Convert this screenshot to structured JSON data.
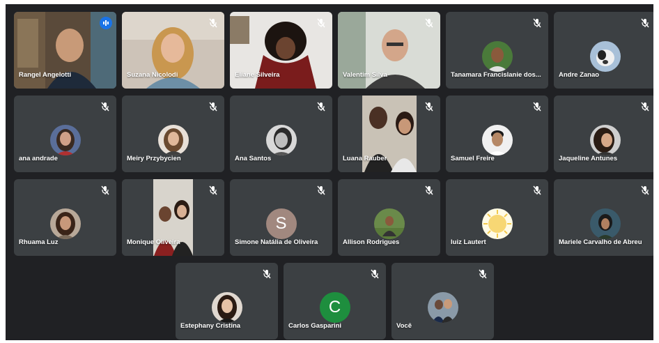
{
  "meeting": {
    "colors": {
      "background": "#202124",
      "tile": "#3c4043",
      "speaking_outline": "#8ab4f8",
      "speaking_badge": "#1a73e8"
    },
    "participants": [
      {
        "name": "Rangel Angelotti",
        "type": "video",
        "speaking": true,
        "muted": false
      },
      {
        "name": "Suzana Nicolodi",
        "type": "video",
        "muted": true
      },
      {
        "name": "Eliane Silveira",
        "type": "video",
        "muted": true
      },
      {
        "name": "Valentim Silva",
        "type": "video",
        "muted": true
      },
      {
        "name": "Tanamara Francislanie dos...",
        "type": "avatar",
        "muted": true
      },
      {
        "name": "Andre Zanao",
        "type": "avatar",
        "muted": true
      },
      {
        "name": "ana andrade",
        "type": "avatar",
        "muted": true
      },
      {
        "name": "Meiry Przybycien",
        "type": "avatar",
        "muted": true
      },
      {
        "name": "Ana Santos",
        "type": "avatar",
        "muted": true
      },
      {
        "name": "Luana Rauber",
        "type": "video",
        "muted": true
      },
      {
        "name": "Samuel Freire",
        "type": "avatar",
        "muted": true
      },
      {
        "name": "Jaqueline Antunes",
        "type": "avatar",
        "muted": true
      },
      {
        "name": "Rhuama Luz",
        "type": "avatar",
        "muted": true
      },
      {
        "name": "Monique Oliveira",
        "type": "video",
        "muted": true
      },
      {
        "name": "Simone Natália de Oliveira",
        "type": "letter",
        "letter": "S",
        "avatar_color": "#a1887f",
        "muted": true
      },
      {
        "name": "Allison Rodrigues",
        "type": "avatar",
        "muted": true
      },
      {
        "name": "luiz Lautert",
        "type": "avatar",
        "muted": true
      },
      {
        "name": "Mariele Carvalho de Abreu",
        "type": "avatar",
        "muted": true
      },
      {
        "name": "Estephany Cristina",
        "type": "avatar",
        "muted": true
      },
      {
        "name": "Carlos Gasparini",
        "type": "letter",
        "letter": "C",
        "avatar_color": "#1e8e3e",
        "muted": true
      },
      {
        "name": "Você",
        "type": "avatar",
        "muted": true
      }
    ]
  }
}
